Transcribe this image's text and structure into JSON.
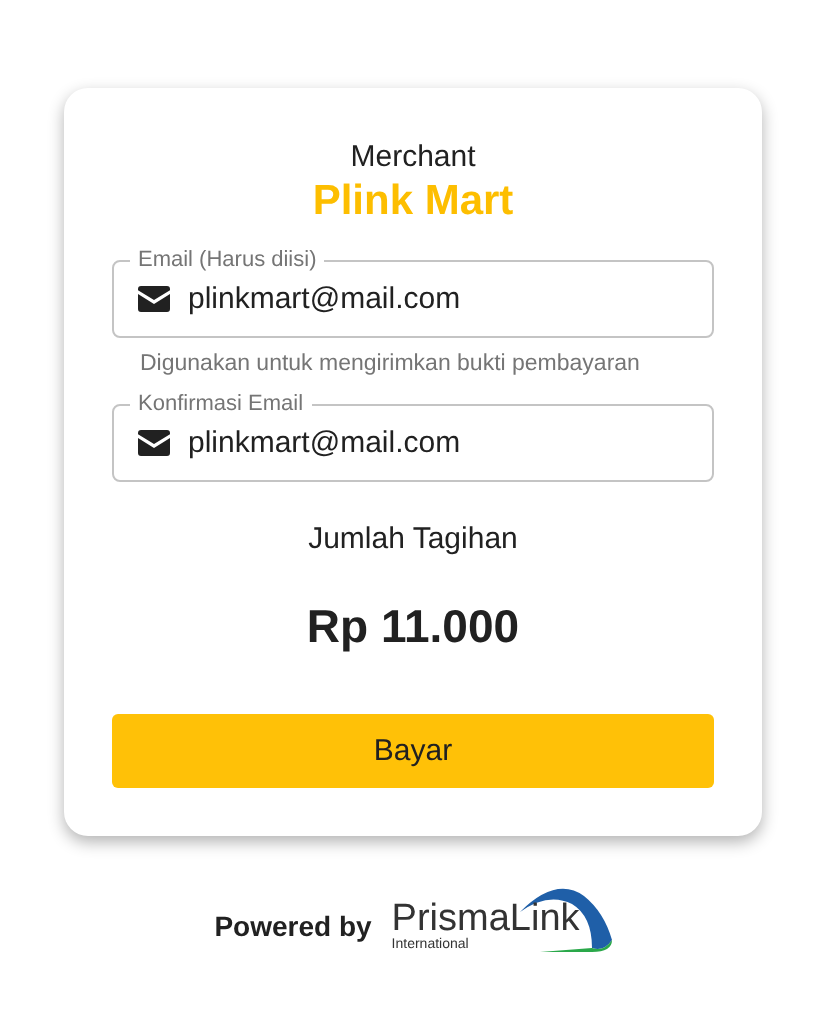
{
  "merchant": {
    "label": "Merchant",
    "name": "Plink Mart"
  },
  "fields": [
    {
      "label": "Email (Harus diisi)",
      "value": "plinkmart@mail.com",
      "helper": "Digunakan untuk mengirimkan bukti pembayaran"
    },
    {
      "label": "Konfirmasi Email",
      "value": "plinkmart@mail.com"
    }
  ],
  "total": {
    "label": "Jumlah Tagihan",
    "amount": "Rp 11.000"
  },
  "pay_button": "Bayar",
  "footer": {
    "powered_by": "Powered by",
    "logo_name": "PrismaLink",
    "logo_sub": "International"
  }
}
